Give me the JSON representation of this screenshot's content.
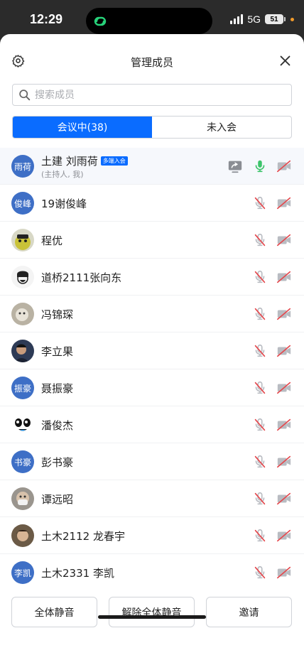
{
  "status": {
    "time": "12:29",
    "network": "5G",
    "battery": "51"
  },
  "header": {
    "title": "管理成员"
  },
  "search": {
    "placeholder": "搜索成员"
  },
  "tabs": [
    {
      "label": "会议中(38)",
      "active": true
    },
    {
      "label": "未入会",
      "active": false
    }
  ],
  "participants": [
    {
      "name": "土建 刘雨荷",
      "sub": "(主持人, 我)",
      "badge": "多端入会",
      "avatar_text": "雨荷",
      "avatar": "text",
      "sharing": true,
      "mic_on": true,
      "cam_on": false
    },
    {
      "name": "19谢俊峰",
      "avatar_text": "俊峰",
      "avatar": "text",
      "mic_on": false,
      "cam_on": false
    },
    {
      "name": "程优",
      "avatar": "photo-cartoon",
      "mic_on": false,
      "cam_on": false
    },
    {
      "name": "道桥2111张向东",
      "avatar": "photo-sketch",
      "mic_on": false,
      "cam_on": false
    },
    {
      "name": "冯锦琛",
      "avatar": "photo-cat",
      "mic_on": false,
      "cam_on": false
    },
    {
      "name": "李立果",
      "avatar": "photo-person",
      "mic_on": false,
      "cam_on": false
    },
    {
      "name": "聂振豪",
      "avatar_text": "振豪",
      "avatar": "text",
      "mic_on": false,
      "cam_on": false
    },
    {
      "name": "潘俊杰",
      "avatar": "photo-face",
      "mic_on": false,
      "cam_on": false
    },
    {
      "name": "彭书豪",
      "avatar_text": "书豪",
      "avatar": "text",
      "mic_on": false,
      "cam_on": false
    },
    {
      "name": "谭远昭",
      "avatar": "photo-mask",
      "mic_on": false,
      "cam_on": false
    },
    {
      "name": "土木2112 龙春宇",
      "avatar": "photo-woman",
      "mic_on": false,
      "cam_on": false
    },
    {
      "name": "土木2331 李凯",
      "avatar_text": "李凯",
      "avatar": "text",
      "mic_on": false,
      "cam_on": false
    }
  ],
  "footer": {
    "mute_all": "全体静音",
    "unmute_all": "解除全体静音",
    "invite": "邀请"
  },
  "colors": {
    "accent": "#0a6cff",
    "muted_red": "#e5484d",
    "mic_active": "#3cc46a"
  }
}
